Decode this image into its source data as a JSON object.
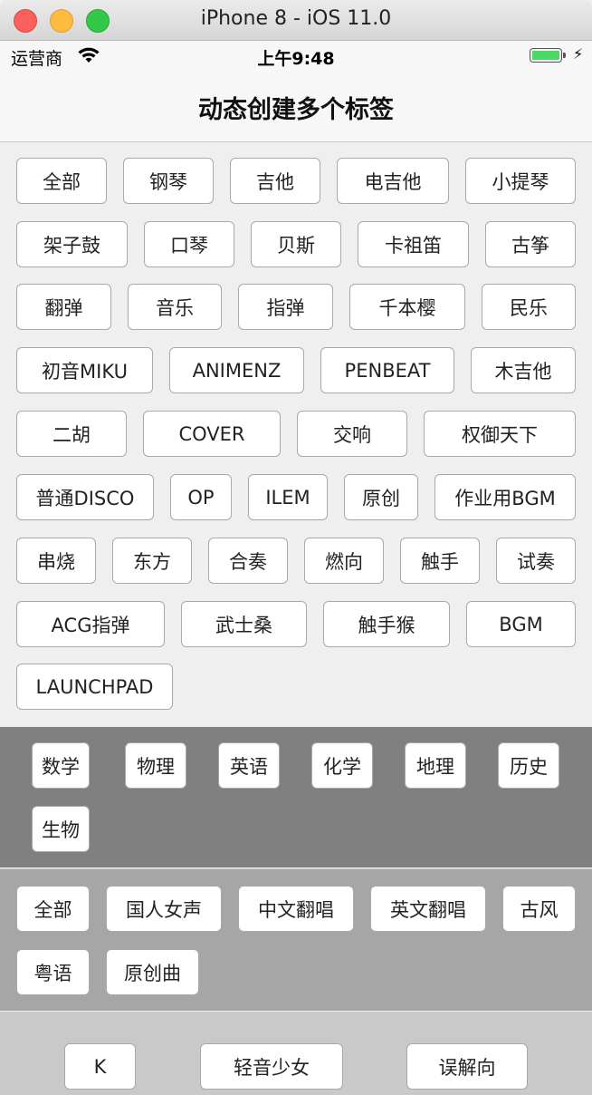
{
  "window": {
    "title": "iPhone 8 - iOS 11.0"
  },
  "status_bar": {
    "carrier": "运营商",
    "time": "上午9:48"
  },
  "nav": {
    "title": "动态创建多个标签"
  },
  "section1": {
    "tags": [
      "全部",
      "钢琴",
      "吉他",
      "电吉他",
      "小提琴",
      "架子鼓",
      "口琴",
      "贝斯",
      "卡祖笛",
      "古筝",
      "翻弹",
      "音乐",
      "指弹",
      "千本樱",
      "民乐",
      "初音MIKU",
      "ANIMENZ",
      "PENBEAT",
      "木吉他",
      "二胡",
      "COVER",
      "交响",
      "权御天下",
      "普通DISCO",
      "OP",
      "ILEM",
      "原创",
      "作业用BGM",
      "串烧",
      "东方",
      "合奏",
      "燃向",
      "触手",
      "试奏",
      "ACG指弹",
      "武士桑",
      "触手猴",
      "BGM",
      "LAUNCHPAD"
    ]
  },
  "section2": {
    "tags": [
      "数学",
      "物理",
      "英语",
      "化学",
      "地理",
      "历史",
      "生物"
    ]
  },
  "section3": {
    "tags": [
      "全部",
      "国人女声",
      "中文翻唱",
      "英文翻唱",
      "古风",
      "粤语",
      "原创曲"
    ]
  },
  "section4": {
    "tags": [
      "K",
      "轻音少女",
      "误解向"
    ]
  }
}
